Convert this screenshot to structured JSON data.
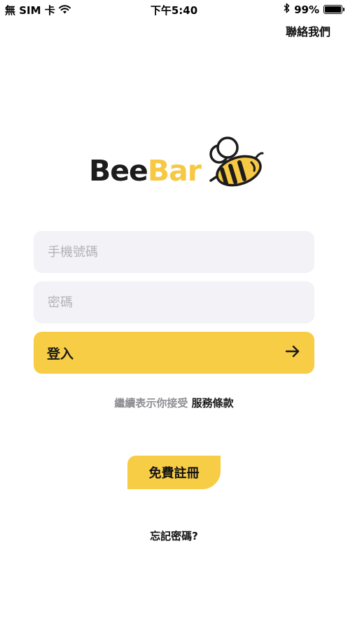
{
  "status_bar": {
    "carrier": "無 SIM 卡",
    "time": "下午5:40",
    "battery_percent": "99%",
    "battery_level": 0.99,
    "icons": [
      "wifi-icon",
      "bluetooth-icon",
      "battery-icon"
    ]
  },
  "header": {
    "contact_label": "聯絡我們"
  },
  "logo": {
    "bee_text": "Bee",
    "bar_text": "Bar",
    "brand_yellow": "#f6c843",
    "brand_dark": "#1c1c1c"
  },
  "form": {
    "phone_placeholder": "手機號碼",
    "phone_value": "",
    "password_placeholder": "密碼",
    "password_value": "",
    "login_label": "登入",
    "login_icon": "arrow-right-icon"
  },
  "terms": {
    "prefix": "繼續表示你接受",
    "link": "服務條款"
  },
  "register_label": "免費註冊",
  "forgot_label": "忘記密碼?",
  "colors": {
    "accent": "#f8cd46",
    "field_bg": "#f2f2f7",
    "placeholder": "#b3b3b8",
    "muted_text": "#8e8e93"
  }
}
